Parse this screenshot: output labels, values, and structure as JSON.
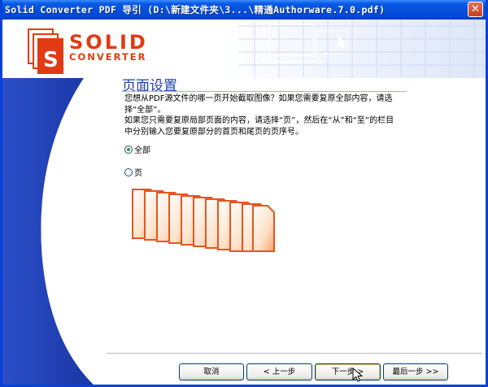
{
  "window": {
    "title": "Solid Converter PDF 导引 (D:\\新建文件夹\\3...\\精通Authorware.7.0.pdf)",
    "close_glyph": "✕"
  },
  "logo": {
    "line1": "SOLID",
    "line2": "CONVERTER",
    "brand_color": "#e23a14"
  },
  "page": {
    "title": "页面设置",
    "paragraph1": "您想从PDF源文件的哪一页开始截取图像？如果您需要复原全部内容，请选择“全部”。",
    "paragraph2": "如果您只需要复原局部页面的内容，请选择“页”，然后在“从”和“至”的栏目中分别输入您要复原部分的首页和尾页的页序号。"
  },
  "options": [
    {
      "label": "全部",
      "selected": true
    },
    {
      "label": "页",
      "selected": false
    }
  ],
  "buttons": {
    "cancel": "取消",
    "back": "< 上一步",
    "next": "下一步 >",
    "finish": "最后一步 >>"
  },
  "colors": {
    "accent_blue": "#1a3fa8",
    "title_blue": "#1c3fb0",
    "page_orange": "#e8561e"
  }
}
